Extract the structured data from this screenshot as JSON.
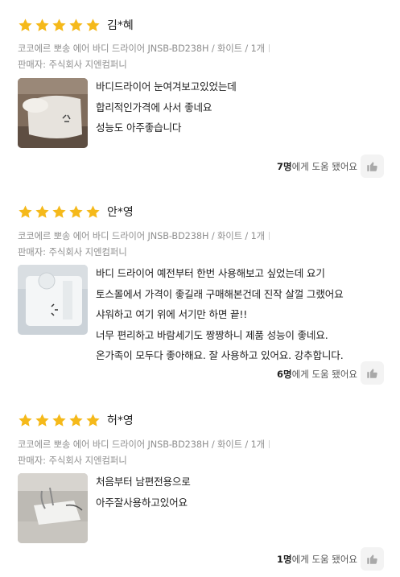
{
  "reviews": [
    {
      "rating": 5,
      "author": "김*혜",
      "product": "코코에르 뽀송 에어 바디 드라이어 JNSB-BD238H / 화이트 / 1개",
      "seller": "판매자: 주식회사 지엔컴퍼니",
      "lines": [
        "바디드라이어 눈여겨보고있었는데",
        "합리적인가격에 사서 좋네요",
        "성능도 아주좋습니다"
      ],
      "helpful_count": "7명",
      "helpful_suffix": "에게 도움 됐어요"
    },
    {
      "rating": 5,
      "author": "안*영",
      "product": "코코에르 뽀송 에어 바디 드라이어 JNSB-BD238H / 화이트 / 1개",
      "seller": "판매자: 주식회사 지엔컴퍼니",
      "lines": [
        "바디 드라이어 예전부터 한번 사용해보고 싶었는데 요기",
        "토스몰에서 가격이 좋길래 구매해본건데 진작 살껄 그랬어요",
        "샤워하고 여기 위에 서기만 하면 끝!!",
        "너무 편리하고 바람세기도 짱짱하니 제품 성능이 좋네요.",
        "온가족이 모두다 좋아해요. 잘 사용하고  있어요. 강추합니다."
      ],
      "helpful_count": "6명",
      "helpful_suffix": "에게 도움 됐어요"
    },
    {
      "rating": 5,
      "author": "허*영",
      "product": "코코에르 뽀송 에어 바디 드라이어 JNSB-BD238H / 화이트 / 1개",
      "seller": "판매자: 주식회사 지엔컴퍼니",
      "lines": [
        "처음부터 남편전용으로",
        "아주잘사용하고있어요"
      ],
      "helpful_count": "1명",
      "helpful_suffix": "에게 도움 됐어요"
    }
  ],
  "colors": {
    "star": "#f5b91a",
    "meta_text": "#8e8e8e",
    "like_bg": "#f3f3f3"
  },
  "icons": {
    "star": "star-icon",
    "like": "thumbs-up-icon"
  }
}
